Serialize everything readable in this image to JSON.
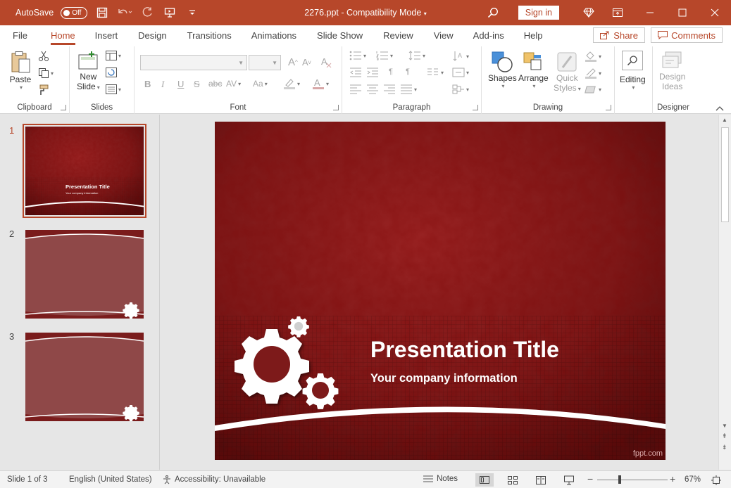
{
  "titlebar": {
    "autosave_label": "AutoSave",
    "autosave_state": "Off",
    "document_title": "2276.ppt  -  Compatibility Mode",
    "signin_label": "Sign in"
  },
  "tabs": [
    {
      "label": "File"
    },
    {
      "label": "Home"
    },
    {
      "label": "Insert"
    },
    {
      "label": "Design"
    },
    {
      "label": "Transitions"
    },
    {
      "label": "Animations"
    },
    {
      "label": "Slide Show"
    },
    {
      "label": "Review"
    },
    {
      "label": "View"
    },
    {
      "label": "Add-ins"
    },
    {
      "label": "Help"
    }
  ],
  "active_tab": "Home",
  "share_label": "Share",
  "comments_label": "Comments",
  "ribbon": {
    "clipboard": {
      "label": "Clipboard",
      "paste": "Paste"
    },
    "slides": {
      "label": "Slides",
      "new_slide_1": "New",
      "new_slide_2": "Slide"
    },
    "font": {
      "label": "Font"
    },
    "paragraph": {
      "label": "Paragraph"
    },
    "drawing": {
      "label": "Drawing",
      "shapes": "Shapes",
      "arrange": "Arrange",
      "quick_styles_1": "Quick",
      "quick_styles_2": "Styles"
    },
    "editing": {
      "label": "Editing"
    },
    "designer": {
      "label": "Designer",
      "design_ideas_1": "Design",
      "design_ideas_2": "Ideas"
    }
  },
  "thumbnails": [
    {
      "number": "1",
      "title": "Presentation Title",
      "subtitle": "Your company information"
    },
    {
      "number": "2"
    },
    {
      "number": "3"
    }
  ],
  "slide": {
    "title": "Presentation Title",
    "subtitle": "Your company information",
    "watermark": "fppt.com"
  },
  "statusbar": {
    "slide_info": "Slide 1 of 3",
    "language": "English (United States)",
    "accessibility": "Accessibility: Unavailable",
    "notes": "Notes",
    "zoom": "67%"
  },
  "colors": {
    "accent": "#b7472a",
    "slide_red": "#7d1a1a"
  }
}
